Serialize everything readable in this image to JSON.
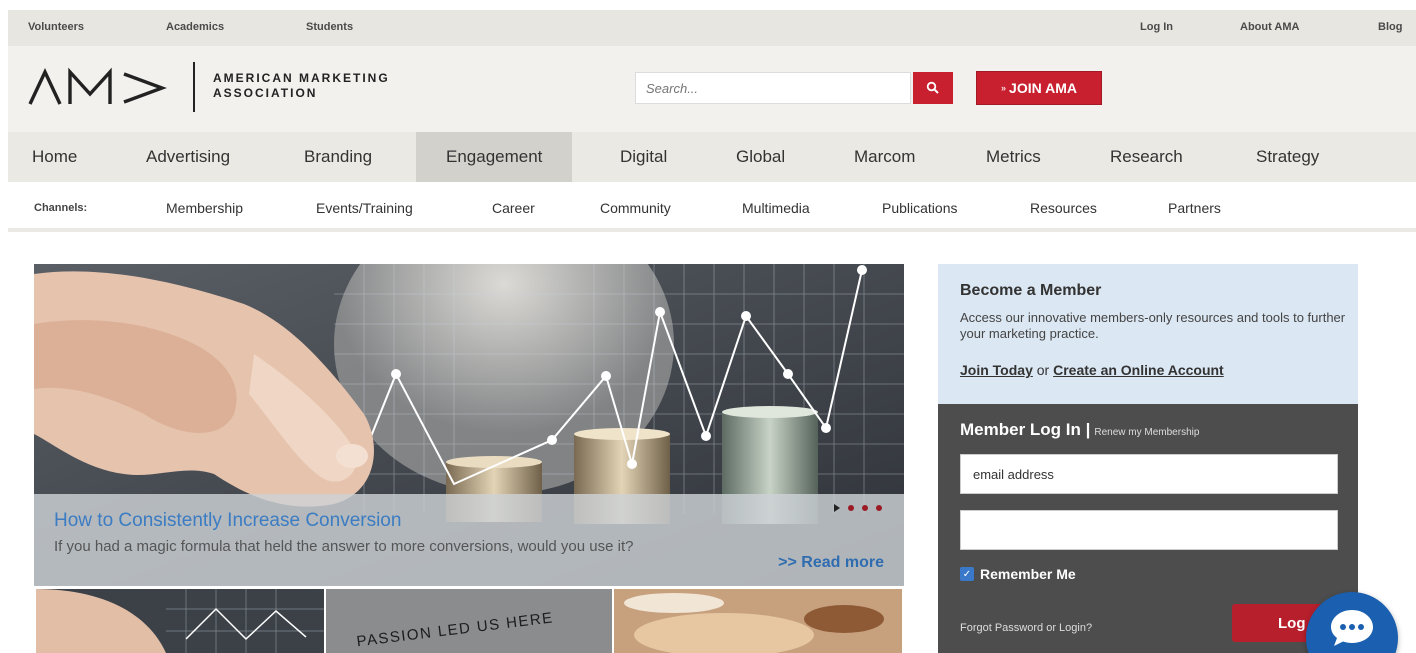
{
  "topbar": {
    "left_links": [
      "Volunteers",
      "Academics",
      "Students"
    ],
    "right_links": [
      "Log In",
      "About AMA",
      "Blog"
    ]
  },
  "header": {
    "logo_text_line1": "AMERICAN MARKETING",
    "logo_text_line2": "ASSOCIATION",
    "search_placeholder": "Search...",
    "join_label": "JOIN AMA",
    "join_prefix": "»"
  },
  "mainnav": {
    "items": [
      "Home",
      "Advertising",
      "Branding",
      "Engagement",
      "Digital",
      "Global",
      "Marcom",
      "Metrics",
      "Research",
      "Strategy"
    ],
    "active": "Engagement"
  },
  "channels": {
    "label": "Channels:",
    "items": [
      "Membership",
      "Events/Training",
      "Career",
      "Community",
      "Multimedia",
      "Publications",
      "Resources",
      "Partners"
    ]
  },
  "hero": {
    "title": "How to Consistently Increase Conversion",
    "description": "If you had a magic formula that held the answer to more conversions, would you use it?",
    "read_more": ">> Read more"
  },
  "thumbs": {
    "second_text": "PASSION LED US HERE"
  },
  "member": {
    "title": "Become a Member",
    "description": "Access our innovative members-only resources and tools to further your marketing practice.",
    "join_link": "Join Today",
    "or_text": "or",
    "create_link": "Create an Online Account"
  },
  "login": {
    "title": "Member Log In |",
    "renew": "Renew my Membership",
    "email_value": "email address",
    "password_value": "",
    "remember": "Remember Me",
    "forgot": "Forgot Password or Login?",
    "button": "Log In"
  },
  "colors": {
    "brand_red": "#c8202f",
    "link_blue": "#3b7cc2",
    "chat_blue": "#1b5fb0"
  }
}
